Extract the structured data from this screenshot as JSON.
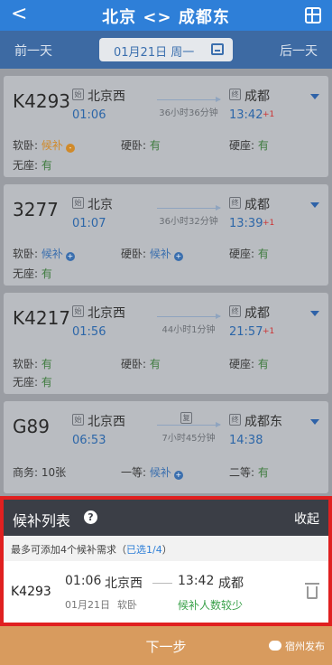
{
  "header": {
    "title": "北京 <> 成都东",
    "back": "<"
  },
  "datebar": {
    "prev": "前一天",
    "date": "01月21日 周一",
    "next": "后一天"
  },
  "trains": [
    {
      "no": "K4293",
      "from_badge": "始",
      "from": "北京西",
      "dep": "01:06",
      "duration": "36小时36分钟",
      "to_badge": "终",
      "to": "成都",
      "arr": "13:42",
      "plus": "+1",
      "seats": [
        {
          "label": "软卧:",
          "value": "候补"
        },
        {
          "label": "硬卧:",
          "value": "有"
        },
        {
          "label": "硬座:",
          "value": "有"
        },
        {
          "label": "无座:",
          "value": "有"
        }
      ]
    },
    {
      "no": "3277",
      "from_badge": "始",
      "from": "北京",
      "dep": "01:07",
      "duration": "36小时32分钟",
      "to_badge": "终",
      "to": "成都",
      "arr": "13:39",
      "plus": "+1",
      "seats": [
        {
          "label": "软卧:",
          "value": "候补"
        },
        {
          "label": "硬卧:",
          "value": "候补"
        },
        {
          "label": "硬座:",
          "value": "有"
        },
        {
          "label": "无座:",
          "value": "有"
        }
      ]
    },
    {
      "no": "K4217",
      "from_badge": "始",
      "from": "北京西",
      "dep": "01:56",
      "duration": "44小时1分钟",
      "to_badge": "终",
      "to": "成都",
      "arr": "21:57",
      "plus": "+1",
      "seats": [
        {
          "label": "软卧:",
          "value": "有"
        },
        {
          "label": "硬卧:",
          "value": "有"
        },
        {
          "label": "硬座:",
          "value": "有"
        },
        {
          "label": "无座:",
          "value": "有"
        }
      ]
    },
    {
      "no": "G89",
      "from_badge": "始",
      "from": "北京西",
      "dep": "06:53",
      "duration": "7小时45分钟",
      "mid_badge": "复",
      "to_badge": "终",
      "to": "成都东",
      "arr": "14:38",
      "plus": "",
      "seats": [
        {
          "label": "商务:",
          "value": "10张"
        },
        {
          "label": "一等:",
          "value": "候补"
        },
        {
          "label": "二等:",
          "value": "有"
        }
      ]
    }
  ],
  "waitlist": {
    "title": "候补列表",
    "help": "?",
    "collapse": "收起",
    "note_prefix": "最多可添加4个候补需求（",
    "note_selected": "已选1/4",
    "note_suffix": "）",
    "item": {
      "no": "K4293",
      "dep": "01:06",
      "from": "北京西",
      "arr": "13:42",
      "to": "成都",
      "date": "01月21日",
      "seat": "软卧",
      "status": "候补人数较少"
    }
  },
  "footer": {
    "next": "下一步",
    "watermark": "宿州发布"
  },
  "colors": {
    "header": "#2e7fd8",
    "frame": "#e02020",
    "footer": "#d89b5e",
    "status_green": "#3aa14a"
  }
}
